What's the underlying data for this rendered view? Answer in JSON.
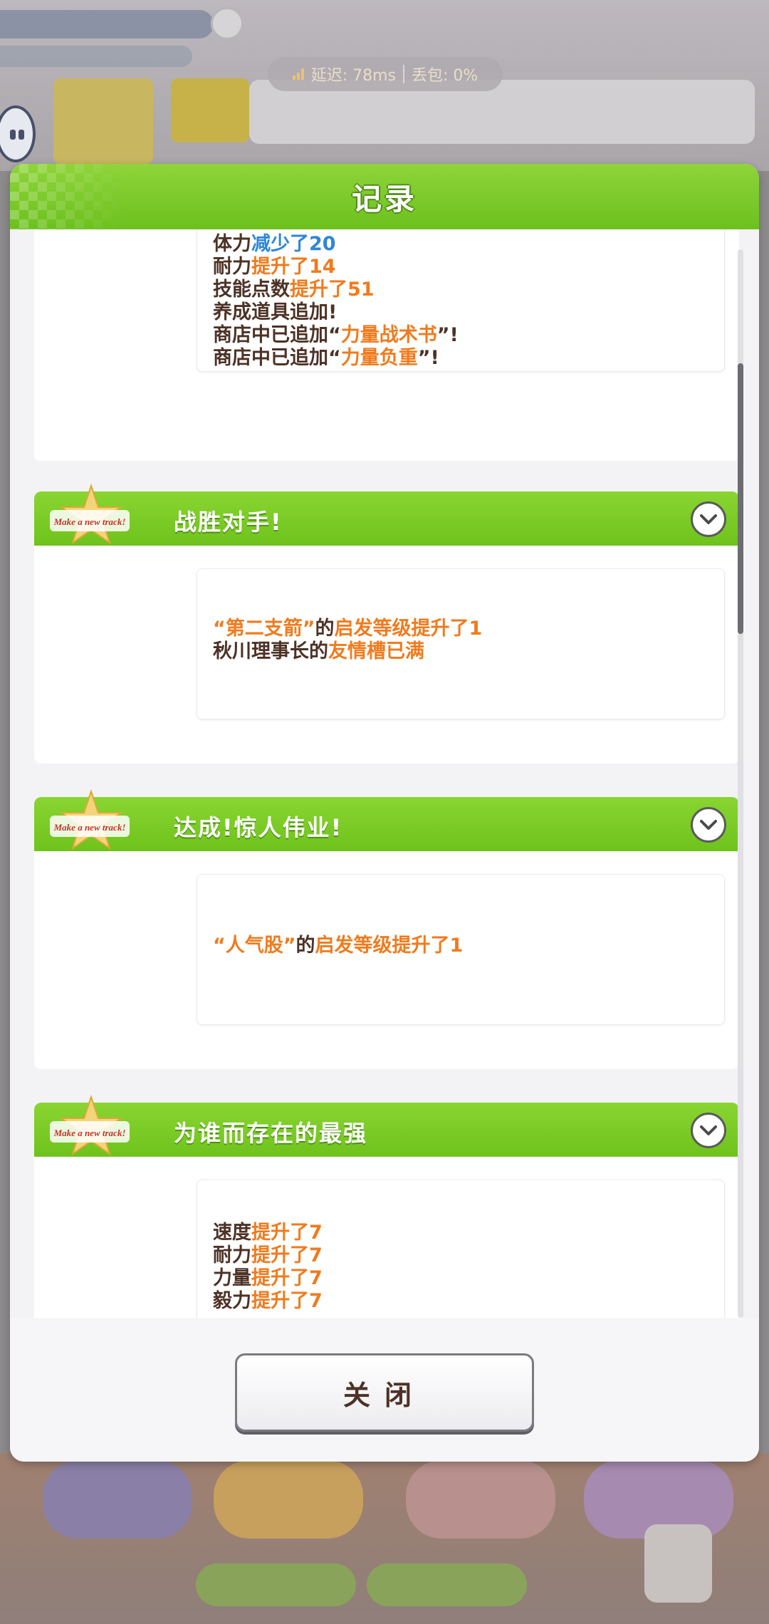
{
  "network": {
    "latency": "延迟: 78ms",
    "packet_loss": "丢包: 0%"
  },
  "modal": {
    "title": "记录",
    "close_label": "关闭"
  },
  "badge_text": "Make a new track!",
  "sections": [
    {
      "lines": [
        [
          {
            "t": "体力",
            "c": "dark"
          },
          {
            "t": "减少了20",
            "c": "blue"
          }
        ],
        [
          {
            "t": "耐力",
            "c": "dark"
          },
          {
            "t": "提升了14",
            "c": "orange"
          }
        ],
        [
          {
            "t": "技能点数",
            "c": "dark"
          },
          {
            "t": "提升了51",
            "c": "orange"
          }
        ],
        [
          {
            "t": "养成道具追加!",
            "c": "dark"
          }
        ],
        [
          {
            "t": "商店中已追加“",
            "c": "dark"
          },
          {
            "t": "力量战术书",
            "c": "orange"
          },
          {
            "t": "”!",
            "c": "dark"
          }
        ],
        [
          {
            "t": "商店中已追加“",
            "c": "dark"
          },
          {
            "t": "力量负重",
            "c": "orange"
          },
          {
            "t": "”!",
            "c": "dark"
          }
        ]
      ]
    },
    {
      "title": "战胜对手!",
      "lines": [
        [
          {
            "t": "“第二支箭”",
            "c": "orange"
          },
          {
            "t": "的",
            "c": "dark"
          },
          {
            "t": "启发等级提升了1",
            "c": "orange"
          }
        ],
        [
          {
            "t": "秋川理事长的",
            "c": "dark"
          },
          {
            "t": "友情槽已满",
            "c": "orange"
          }
        ]
      ]
    },
    {
      "title": "达成!惊人伟业!",
      "lines": [
        [
          {
            "t": "“人气股”",
            "c": "orange"
          },
          {
            "t": "的",
            "c": "dark"
          },
          {
            "t": "启发等级提升了1",
            "c": "orange"
          }
        ]
      ]
    },
    {
      "title": "为谁而存在的最强",
      "lines": [
        [
          {
            "t": "速度",
            "c": "dark"
          },
          {
            "t": "提升了7",
            "c": "orange"
          }
        ],
        [
          {
            "t": "耐力",
            "c": "dark"
          },
          {
            "t": "提升了7",
            "c": "orange"
          }
        ],
        [
          {
            "t": "力量",
            "c": "dark"
          },
          {
            "t": "提升了7",
            "c": "orange"
          }
        ],
        [
          {
            "t": "毅力",
            "c": "dark"
          },
          {
            "t": "提升了7",
            "c": "orange"
          }
        ]
      ]
    }
  ],
  "colors": {
    "header_green": "#7cc927",
    "text_dark": "#4c3226",
    "text_orange": "#f07b1e",
    "text_blue": "#2e86d8"
  }
}
